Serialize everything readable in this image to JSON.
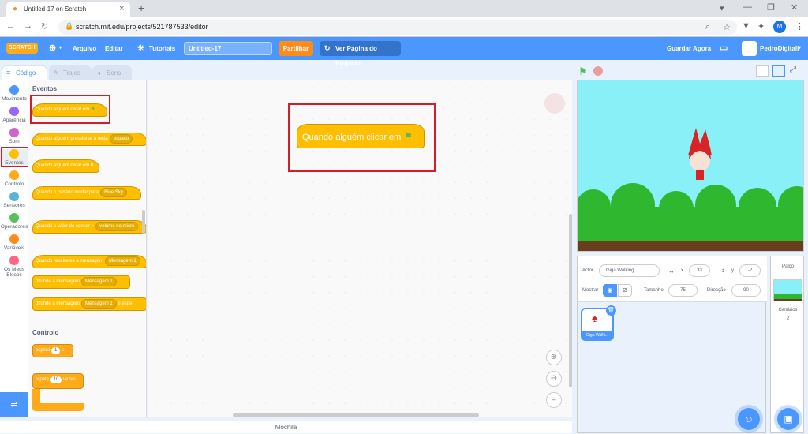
{
  "browser": {
    "tab_title": "Untitled-17 on Scratch",
    "url": "scratch.mit.edu/projects/521787533/editor",
    "profile_initial": "M"
  },
  "menu": {
    "logo": "SCRATCH",
    "arquivo": "Arquivo",
    "editar": "Editar",
    "tutoriais": "Tutoriais",
    "project_title": "Untitled-17",
    "share": "Partilhar",
    "see_project": "Ver Página do Projecto",
    "save_now": "Guardar Agora",
    "username": "PedroDigitalI"
  },
  "tabs": {
    "code": "Código",
    "costumes": "Trajes",
    "sounds": "Sons"
  },
  "categories": [
    {
      "label": "Movimento",
      "color": "#4c97ff"
    },
    {
      "label": "Aparência",
      "color": "#9966ff"
    },
    {
      "label": "Som",
      "color": "#cf63cf"
    },
    {
      "label": "Eventos",
      "color": "#ffbf00"
    },
    {
      "label": "Controlo",
      "color": "#ffab19"
    },
    {
      "label": "Sensores",
      "color": "#5cb1d6"
    },
    {
      "label": "Operadores",
      "color": "#59c059"
    },
    {
      "label": "Variáveis",
      "color": "#ff8c1a"
    },
    {
      "label": "Os Meus Blocos",
      "color": "#ff6680"
    }
  ],
  "palette": {
    "events_heading": "Eventos",
    "b1": "Quando alguém clicar em",
    "b2": "Quando alguém pressionar a tecla",
    "b2_dd": "espaço",
    "b3": "Quando alguém clicar em ti",
    "b4": "Quando o cenário mudar para",
    "b4_dd": "Blue Sky",
    "b5": "Quando o valor do sensor",
    "b5_dd": "volume no micro",
    "b5_gt": ">",
    "b6": "Quando receberes a mensagem",
    "b6_dd": "Mensagem 1",
    "b7": "difunde a mensagem",
    "b7_dd": "Mensagem 1",
    "b8": "difunde a mensagem",
    "b8_dd": "Mensagem 1",
    "b8_tail": "e espe",
    "control_heading": "Controlo",
    "c1": "espera",
    "c1_val": "1",
    "c1_unit": "s",
    "c2": "repete",
    "c2_val": "10",
    "c2_unit": "vezes"
  },
  "workspace": {
    "script_block": "Quando alguém clicar em",
    "backpack": "Mochila"
  },
  "sprite": {
    "actor_label": "Actor",
    "actor_name": "Giga Walking",
    "x_label": "x",
    "x": "33",
    "y_label": "y",
    "y": "-2",
    "show_label": "Mostrar",
    "size_label": "Tamanho",
    "size": "75",
    "direction_label": "Direcção",
    "direction": "90",
    "thumb_label": "Giga Walki..."
  },
  "stage_panel": {
    "title": "Palco",
    "backdrops_label": "Cenários",
    "backdrops_count": "2"
  },
  "colors": {
    "scratch_blue": "#4c97ff",
    "events_yellow": "#ffbf00",
    "highlight_red": "#d01f2a"
  }
}
